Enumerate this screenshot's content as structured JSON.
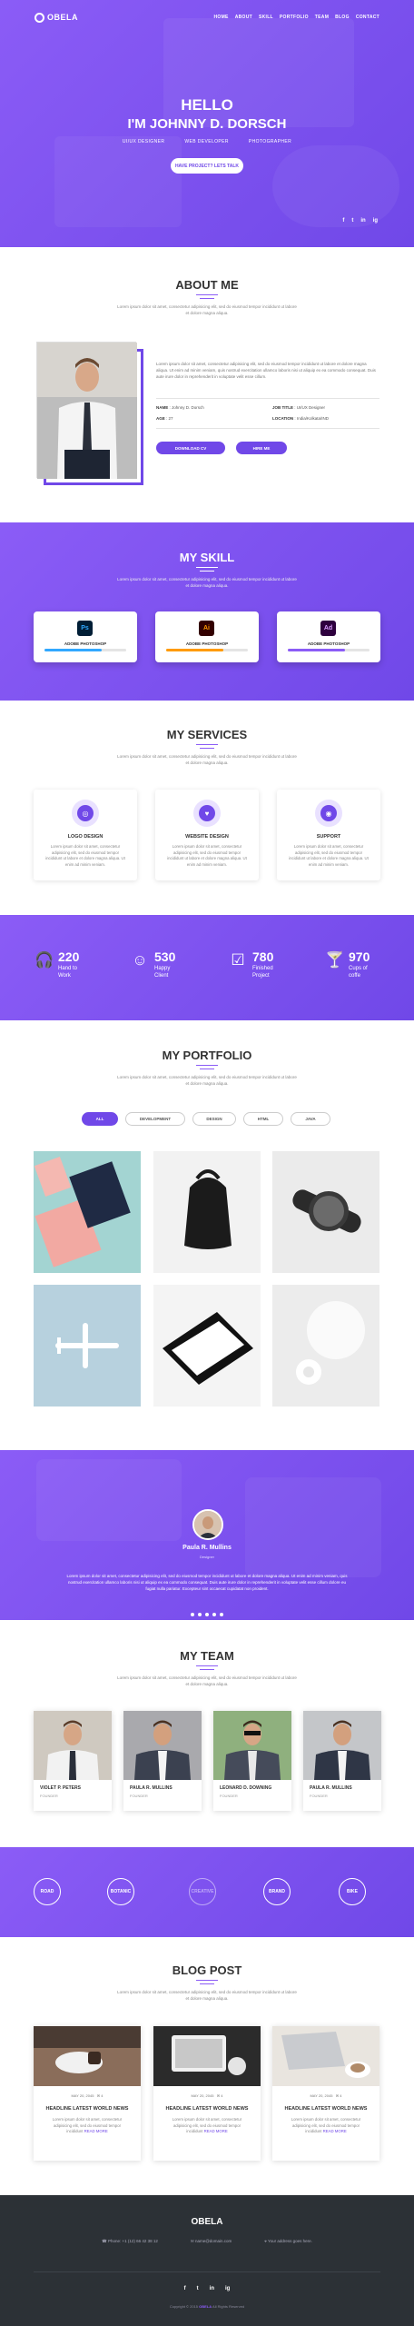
{
  "brand": {
    "name": "OBELA"
  },
  "nav": {
    "items": [
      "HOME",
      "ABOUT",
      "SKILL",
      "PORTFOLIO",
      "TEAM",
      "BLOG",
      "CONTACT"
    ]
  },
  "hero": {
    "greeting": "HELLO",
    "name": "I'M JOHNNY D. DORSCH",
    "roles": [
      "UI/UX DESIGNER",
      "WEB DEVELOPER",
      "PHOTOGRAPHER"
    ],
    "cta": "HAVE PROJECT? LETS TALK",
    "social": [
      "f",
      "t",
      "in",
      "ig"
    ]
  },
  "about": {
    "title": "ABOUT ME",
    "subtitle": "Lorem ipsum dolor sit amet, consectetur adipisicing elit, sed do eiusmod tempor incididunt ut labore et dolore magna aliqua.",
    "body": "Lorem ipsum dolor sit amet, consectetur adipisicing elit, sed do eiusmod tempor incididunt ut labore et dolore magna aliqua. Ut enim ad minim veniam, quis nostrud exercitation ullamco laboris nisi ut aliquip ex ea commodo consequat. Duis aute irure dolor in reprehenderit in voluptate velit esse cillum.",
    "name_label": "NAME",
    "name_value": "Johnny D. Dorsch",
    "age_label": "AGE",
    "age_value": "27",
    "job_label": "JOB TITLE",
    "job_value": "UI/UX Designer",
    "loc_label": "LOCATION",
    "loc_value": "India/Kolkata/IND",
    "download": "DOWNLOAD CV",
    "hire": "HIRE ME"
  },
  "skill": {
    "title": "MY SKILL",
    "subtitle": "Lorem ipsum dolor sit amet, consectetur adipisicing elit, sed do eiusmod tempor incididunt ut labore et dolore magna aliqua.",
    "items": [
      {
        "icon": "Ps",
        "label": "ADOBE PHOTOSHOP",
        "percent": 70,
        "color": "#31a8ff",
        "bg": "#001e36"
      },
      {
        "icon": "Ai",
        "label": "ADOBE PHOTOSHOP",
        "percent": 70,
        "color": "#ff9a00",
        "bg": "#330000"
      },
      {
        "icon": "Ad",
        "label": "ADOBE PHOTOSHOP",
        "percent": 70,
        "color": "#8b5cf6",
        "bg": "#2e003e"
      }
    ]
  },
  "services": {
    "title": "MY SERVICES",
    "subtitle": "Lorem ipsum dolor sit amet, consectetur adipisicing elit, sed do eiusmod tempor incididunt ut labore et dolore magna aliqua.",
    "items": [
      {
        "icon": "◎",
        "title": "LOGO DESIGN",
        "text": "Lorem ipsum dolor sit amet, consectetur adipisicing elit, sed do eiusmod tempor incididunt ut labore et dolore magna aliqua. Ut enim ad minim veniam."
      },
      {
        "icon": "♥",
        "title": "WEBSITE DESIGN",
        "text": "Lorem ipsum dolor sit amet, consectetur adipisicing elit, sed do eiusmod tempor incididunt ut labore et dolore magna aliqua. Ut enim ad minim veniam."
      },
      {
        "icon": "◉",
        "title": "SUPPORT",
        "text": "Lorem ipsum dolor sit amet, consectetur adipisicing elit, sed do eiusmod tempor incididunt ut labore et dolore magna aliqua. Ut enim ad minim veniam."
      }
    ]
  },
  "counters": [
    {
      "icon": "🎧",
      "number": "220",
      "label1": "Hand to",
      "label2": "Work"
    },
    {
      "icon": "☺",
      "number": "530",
      "label1": "Happy",
      "label2": "Client"
    },
    {
      "icon": "☑",
      "number": "780",
      "label1": "Finished",
      "label2": "Project"
    },
    {
      "icon": "🍸",
      "number": "970",
      "label1": "Cups of",
      "label2": "coffe"
    }
  ],
  "portfolio": {
    "title": "MY PORTFOLIO",
    "subtitle": "Lorem ipsum dolor sit amet, consectetur adipisicing elit, sed do eiusmod tempor incididunt ut labore et dolore magna aliqua.",
    "tabs": [
      "ALL",
      "DEVELOPMENT",
      "DESIGN",
      "HTML",
      "JAVA"
    ]
  },
  "testimonial": {
    "name": "Paula R. Mullins",
    "role": "Designer",
    "text": "Lorem ipsum dolor sit amet, consectetur adipisicing elit, sed do eiusmod tempor incididunt ut labore et dolore magna aliqua. Ut enim ad minim veniam, quis nostrud exercitation ullamco laboris nisi ut aliquip ex ea commodo consequat. Duis aute irure dolor in reprehenderit in voluptate velit esse cillum dolore eu fugiat nulla pariatur. Excepteur sint occaecat cupidatat non proident."
  },
  "team": {
    "title": "MY TEAM",
    "subtitle": "Lorem ipsum dolor sit amet, consectetur adipisicing elit, sed do eiusmod tempor incididunt ut labore et dolore magna aliqua.",
    "members": [
      {
        "name": "VIOLET P. PETERS",
        "role": "FOUNDER"
      },
      {
        "name": "PAULA R. MULLINS",
        "role": "FOUNDER"
      },
      {
        "name": "LEONARD D. DOWNING",
        "role": "FOUNDER"
      },
      {
        "name": "PAULA R. MULLINS",
        "role": "FOUNDER"
      }
    ]
  },
  "brands": [
    "ROAD",
    "BOTANIC",
    "CREATIVE",
    "BRAND",
    "BIKE"
  ],
  "blog": {
    "title": "BLOG POST",
    "subtitle": "Lorem ipsum dolor sit amet, consectetur adipisicing elit, sed do eiusmod tempor incididunt ut labore et dolore magna aliqua.",
    "posts": [
      {
        "date": "MAY 20, 2045",
        "comments": "4",
        "title": "HEADLINE LATEST WORLD NEWS",
        "text": "Lorem ipsum dolor sit amet, consectetur adipisicing elit, sed do eiusmod tempor incididunt",
        "more": "READ MORE"
      },
      {
        "date": "MAY 20, 2045",
        "comments": "4",
        "title": "HEADLINE LATEST WORLD NEWS",
        "text": "Lorem ipsum dolor sit amet, consectetur adipisicing elit, sed do eiusmod tempor incididunt",
        "more": "READ MORE"
      },
      {
        "date": "MAY 20, 2045",
        "comments": "4",
        "title": "HEADLINE LATEST WORLD NEWS",
        "text": "Lorem ipsum dolor sit amet, consectetur adipisicing elit, sed do eiusmod tempor incididunt",
        "more": "READ MORE"
      }
    ]
  },
  "footer": {
    "title": "OBELA",
    "phone": "Phone: +1 (12) 66 42 38 12",
    "email": "name@domain.com",
    "address": "Your address goes here.",
    "social": [
      "f",
      "t",
      "in",
      "ig"
    ],
    "copyright": "Copyright © 2015",
    "copyright_brand": "OBELA",
    "rights": "All Rights Reserved"
  },
  "colors": {
    "accent": "#7048e8",
    "accent_light": "#8b5cf6",
    "footer": "#2c3136"
  }
}
